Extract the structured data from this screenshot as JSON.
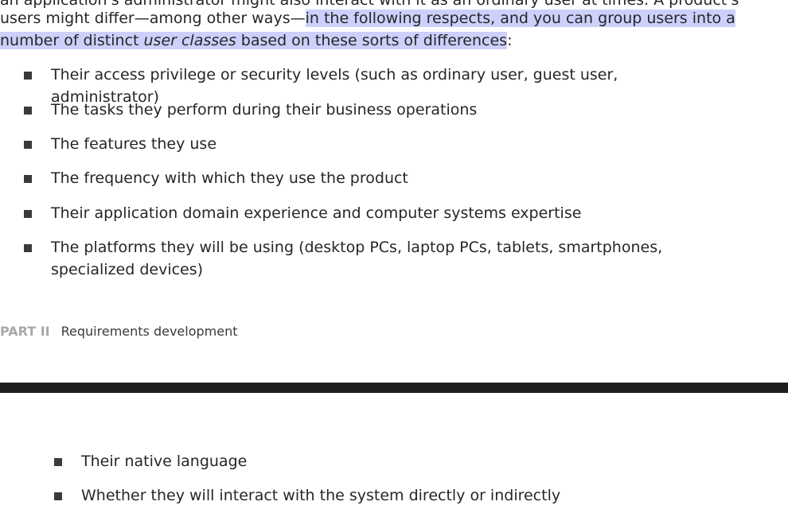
{
  "document": {
    "cut_line": "an application's administrator might also interact with it as an ordinary user at times. A product's",
    "paragraph": {
      "line1_plain": "users might differ—among other ways—",
      "line1_highlight": "in the following respects, and you can group users into a ",
      "line2_highlight_a": "number of distinct ",
      "line2_highlight_em": "user classes",
      "line2_highlight_b": " based on these sorts of differences",
      "line2_tail": ":"
    },
    "bullets": [
      "Their access privilege or security levels (such as ordinary user, guest user, administrator)",
      "The tasks they perform during their business operations",
      "The features they use",
      "The frequency with which they use the product",
      "Their application domain experience and computer systems expertise",
      "The platforms they will be using (desktop PCs, laptop PCs, tablets, smartphones, specialized devices)"
    ],
    "running_head": {
      "part": "PART II",
      "title": "Requirements development"
    },
    "next_page_bullets": [
      "Their native language",
      "Whether they will interact with the system directly or indirectly"
    ]
  }
}
